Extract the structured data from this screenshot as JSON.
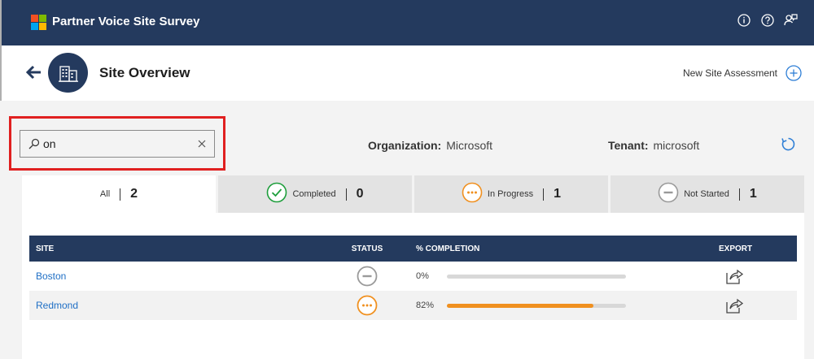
{
  "app": {
    "title": "Partner Voice Site Survey",
    "logo_colors": [
      "#f25022",
      "#7fba00",
      "#00a4ef",
      "#ffb900"
    ],
    "top_icons": [
      "info-icon",
      "help-icon",
      "feedback-icon"
    ]
  },
  "header": {
    "title": "Site Overview",
    "new_assessment_label": "New Site Assessment"
  },
  "search": {
    "value": "on"
  },
  "org": {
    "label": "Organization:",
    "value": "Microsoft"
  },
  "tenant": {
    "label": "Tenant:",
    "value": "microsoft"
  },
  "tabs": [
    {
      "label": "All",
      "count": "2",
      "icon": ""
    },
    {
      "label": "Completed",
      "count": "0",
      "icon": "check-circle-icon"
    },
    {
      "label": "In Progress",
      "count": "1",
      "icon": "ellipsis-circle-icon"
    },
    {
      "label": "Not Started",
      "count": "1",
      "icon": "minus-circle-icon"
    }
  ],
  "table": {
    "headers": {
      "site": "SITE",
      "status": "STATUS",
      "completion": "% COMPLETION",
      "export": "EXPORT"
    },
    "rows": [
      {
        "site": "Boston",
        "status": "Not Started",
        "completion_label": "0%",
        "completion": 0
      },
      {
        "site": "Redmond",
        "status": "In Progress",
        "completion_label": "82%",
        "completion": 82
      }
    ]
  },
  "colors": {
    "nav": "#243a5e",
    "accent_orange": "#f0901f",
    "completed_green": "#1e9e3c",
    "link_blue": "#1f6fc5",
    "highlight_red": "#e02020"
  }
}
